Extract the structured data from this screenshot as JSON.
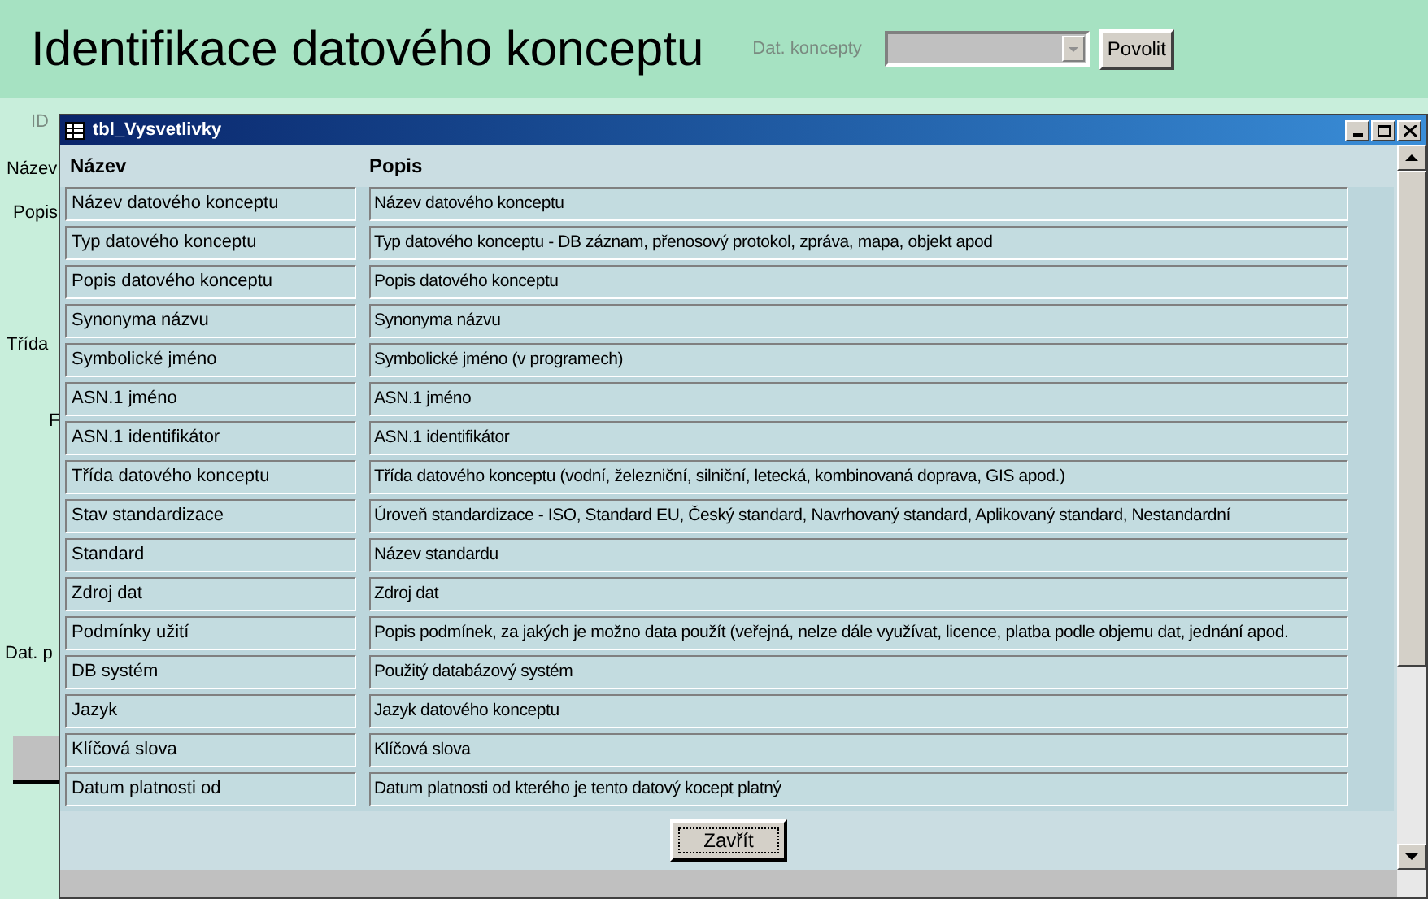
{
  "header": {
    "title": "Identifikace datového konceptu",
    "combo_label": "Dat. koncepty",
    "button": "Povolit"
  },
  "background_labels": [
    "ID",
    "Název",
    "Popis",
    "Třída",
    "F",
    "Dat. p"
  ],
  "dialog": {
    "title": "tbl_Vysvetlivky",
    "columns": [
      "Název",
      "Popis"
    ],
    "rows": [
      {
        "name": "Název datového konceptu",
        "description": "Název datového konceptu"
      },
      {
        "name": "Typ datového konceptu",
        "description": "Typ datového konceptu - DB záznam, přenosový protokol, zpráva, mapa, objekt apod"
      },
      {
        "name": "Popis datového konceptu",
        "description": "Popis datového konceptu"
      },
      {
        "name": "Synonyma názvu",
        "description": "Synonyma názvu"
      },
      {
        "name": "Symbolické jméno",
        "description": "Symbolické jméno (v programech)"
      },
      {
        "name": "ASN.1 jméno",
        "description": "ASN.1 jméno"
      },
      {
        "name": "ASN.1 identifikátor",
        "description": "ASN.1 identifikátor"
      },
      {
        "name": "Třída datového konceptu",
        "description": "Třída datového konceptu (vodní, železniční, silniční, letecká, kombinovaná doprava, GIS apod.)"
      },
      {
        "name": "Stav standardizace",
        "description": "Úroveň standardizace - ISO, Standard EU, Český standard, Navrhovaný standard, Aplikovaný standard, Nestandardní"
      },
      {
        "name": "Standard",
        "description": "Název standardu"
      },
      {
        "name": "Zdroj dat",
        "description": "Zdroj dat"
      },
      {
        "name": "Podmínky užití",
        "description": "Popis podmínek, za jakých je možno data použít (veřejná, nelze dále využívat, licence, platba podle objemu dat, jednání apod."
      },
      {
        "name": "DB systém",
        "description": "Použitý databázový systém"
      },
      {
        "name": "Jazyk",
        "description": "Jazyk datového konceptu"
      },
      {
        "name": "Klíčová slova",
        "description": "Klíčová slova"
      },
      {
        "name": "Datum platnosti od",
        "description": "Datum platnosti od kterého je tento datový kocept platný"
      }
    ],
    "close_button": "Zavřít"
  }
}
